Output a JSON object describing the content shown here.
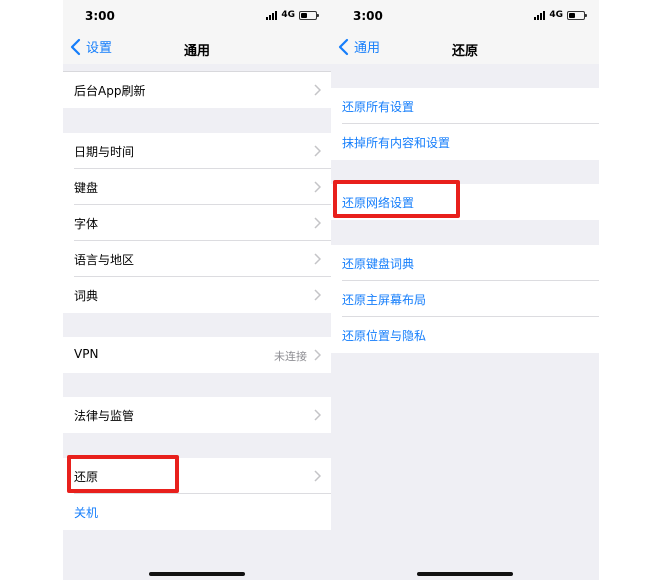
{
  "colors": {
    "accent": "#157efb",
    "highlight": "#e8201c",
    "background": "#efeff4"
  },
  "left": {
    "status": {
      "time": "3:00",
      "network": "4G"
    },
    "nav": {
      "back": "设置",
      "title": "通用"
    },
    "items": {
      "background_refresh": "后台App刷新",
      "date_time": "日期与时间",
      "keyboard": "键盘",
      "font": "字体",
      "language_region": "语言与地区",
      "dictionary": "词典",
      "vpn": "VPN",
      "vpn_status": "未连接",
      "legal": "法律与监管",
      "reset": "还原",
      "shutdown": "关机"
    }
  },
  "right": {
    "status": {
      "time": "3:00",
      "network": "4G"
    },
    "nav": {
      "back": "通用",
      "title": "还原"
    },
    "items": {
      "reset_all": "还原所有设置",
      "erase_all": "抹掉所有内容和设置",
      "reset_network": "还原网络设置",
      "reset_keyboard_dict": "还原键盘词典",
      "reset_home_layout": "还原主屏幕布局",
      "reset_location_privacy": "还原位置与隐私"
    }
  },
  "icons": {
    "back": "chevron-left-icon",
    "disclosure": "chevron-right-icon",
    "signal": "cellular-signal-icon",
    "battery": "battery-icon"
  }
}
